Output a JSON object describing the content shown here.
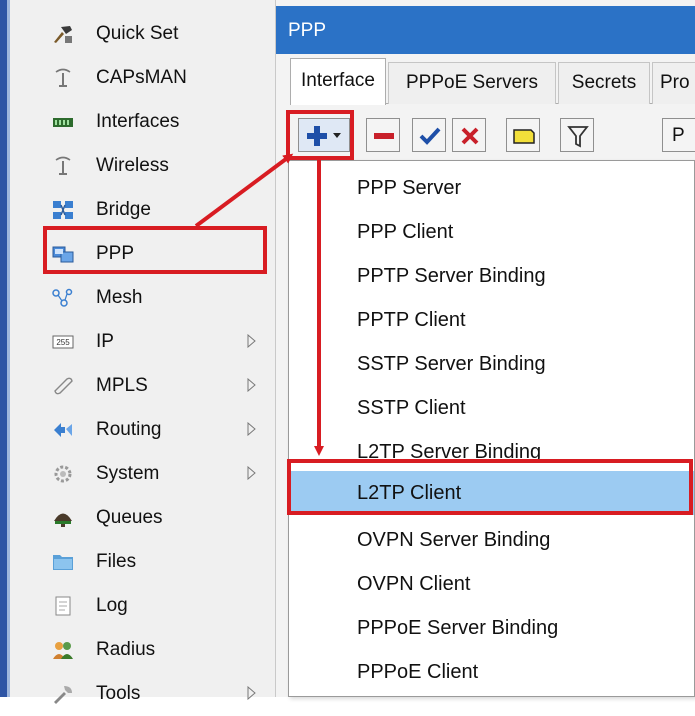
{
  "sidebar": {
    "items": [
      {
        "label": "Quick Set",
        "icon": "quick-set-icon",
        "submenu": false
      },
      {
        "label": "CAPsMAN",
        "icon": "antenna-icon",
        "submenu": false
      },
      {
        "label": "Interfaces",
        "icon": "interfaces-icon",
        "submenu": false
      },
      {
        "label": "Wireless",
        "icon": "wireless-icon",
        "submenu": false
      },
      {
        "label": "Bridge",
        "icon": "bridge-icon",
        "submenu": false
      },
      {
        "label": "PPP",
        "icon": "ppp-icon",
        "submenu": false
      },
      {
        "label": "Mesh",
        "icon": "mesh-icon",
        "submenu": false
      },
      {
        "label": "IP",
        "icon": "ip-icon",
        "submenu": true
      },
      {
        "label": "MPLS",
        "icon": "mpls-icon",
        "submenu": true
      },
      {
        "label": "Routing",
        "icon": "routing-icon",
        "submenu": true
      },
      {
        "label": "System",
        "icon": "system-gear-icon",
        "submenu": true
      },
      {
        "label": "Queues",
        "icon": "queues-icon",
        "submenu": false
      },
      {
        "label": "Files",
        "icon": "folder-icon",
        "submenu": false
      },
      {
        "label": "Log",
        "icon": "log-icon",
        "submenu": false
      },
      {
        "label": "Radius",
        "icon": "radius-icon",
        "submenu": false
      },
      {
        "label": "Tools",
        "icon": "tools-icon",
        "submenu": true
      }
    ],
    "ip_badge": "255"
  },
  "window": {
    "title": "PPP",
    "tabs": [
      "Interface",
      "PPPoE Servers",
      "Secrets",
      "Pro"
    ],
    "toolbar": {
      "partial_label": "P",
      "icons": [
        "add-icon",
        "chevron-down-icon",
        "remove-icon",
        "enable-check-icon",
        "disable-x-icon",
        "comment-icon",
        "filter-icon"
      ]
    }
  },
  "menu": {
    "items": [
      "PPP Server",
      "PPP Client",
      "PPTP Server Binding",
      "PPTP Client",
      "SSTP Server Binding",
      "SSTP Client",
      "L2TP Server Binding",
      "L2TP Client",
      "OVPN Server Binding",
      "OVPN Client",
      "PPPoE Server Binding",
      "PPPoE Client"
    ],
    "selected": "L2TP Client"
  },
  "colors": {
    "title_bar": "#2b72c6",
    "highlight": "#d81c22",
    "selection": "#9ccbf2"
  }
}
